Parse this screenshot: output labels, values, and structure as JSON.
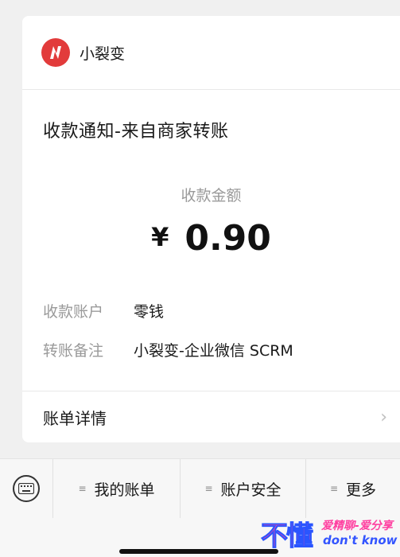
{
  "header": {
    "app_name": "小裂变",
    "logo_icon": "lightning-n-logo"
  },
  "notice": {
    "title": "收款通知-来自商家转账"
  },
  "amount": {
    "label": "收款金额",
    "currency": "¥",
    "value": "0.90"
  },
  "details": [
    {
      "key": "收款账户",
      "value": "零钱"
    },
    {
      "key": "转账备注",
      "value": "小裂变-企业微信 SCRM"
    }
  ],
  "bill_detail": {
    "label": "账单详情",
    "chevron": "›"
  },
  "bottom_menu": {
    "keyboard_icon": "keyboard-icon",
    "items": [
      {
        "label": "我的账单"
      },
      {
        "label": "账户安全"
      },
      {
        "label": "更多"
      }
    ],
    "menu_icon_glyph": "≡"
  },
  "watermark": {
    "big": "不懂",
    "line1": "爱精聊-爱分享",
    "line2": "don't know"
  },
  "colors": {
    "brand_red": "#e23b3b",
    "muted_text": "#9a9a9a",
    "watermark_pink": "#ff3fa0",
    "watermark_blue": "#3355ff"
  }
}
